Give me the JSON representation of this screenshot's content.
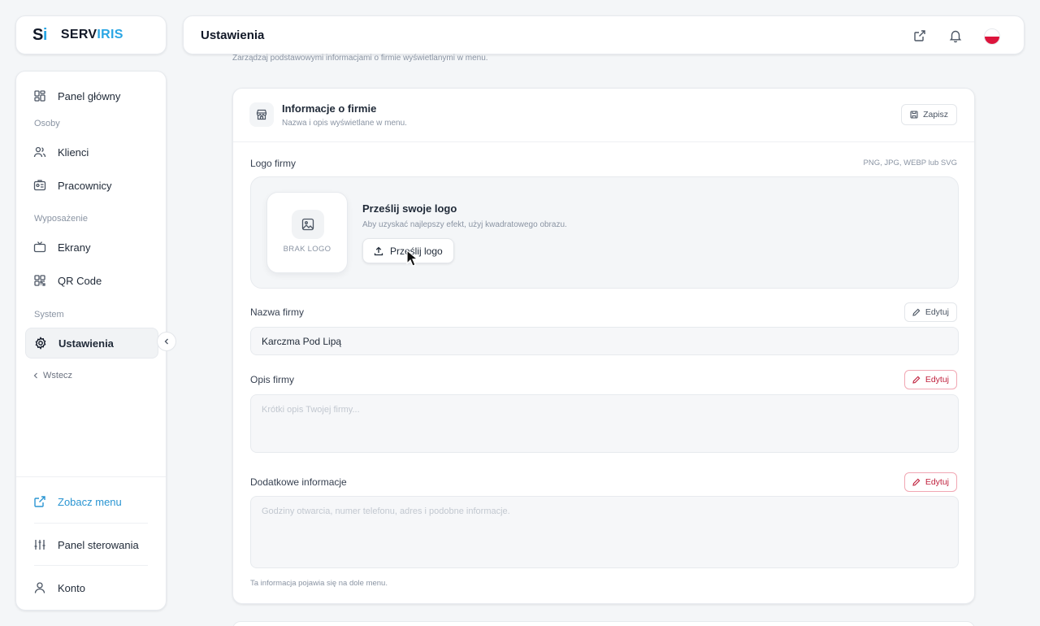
{
  "brand": {
    "mark_s": "S",
    "mark_i": "i",
    "name_main": "SERV",
    "name_accent": "IRIS"
  },
  "sidebar": {
    "items": [
      {
        "label": "Panel główny",
        "icon": "dashboard-icon"
      },
      {
        "label": "Klienci",
        "icon": "users-icon"
      },
      {
        "label": "Pracownicy",
        "icon": "id-card-icon"
      },
      {
        "label": "Ekrany",
        "icon": "tv-icon"
      },
      {
        "label": "QR Code",
        "icon": "qr-code-icon"
      },
      {
        "label": "Ustawienia",
        "icon": "gear-icon",
        "active": true
      }
    ],
    "sections": {
      "people": "Osoby",
      "equipment": "Wyposażenie",
      "system": "System"
    },
    "back_label": "Wstecz",
    "bottom": {
      "view_menu": "Zobacz menu",
      "control_panel": "Panel sterowania",
      "account": "Konto"
    }
  },
  "topbar": {
    "title": "Ustawienia",
    "icons": [
      "external-link-icon",
      "bell-icon",
      "poland-flag-icon"
    ]
  },
  "page": {
    "subtitle": "Zarządzaj podstawowymi informacjami o firmie wyświetlanymi w menu."
  },
  "card": {
    "title": "Informacje o firmie",
    "subtitle": "Nazwa i opis wyświetlane w menu.",
    "save_label": "Zapisz",
    "logo": {
      "label": "Logo firmy",
      "formats": "PNG, JPG, WEBP lub SVG",
      "placeholder": "BRAK LOGO",
      "upload_title": "Prześlij swoje logo",
      "upload_hint": "Aby uzyskać najlepszy efekt, użyj kwadratowego obrazu.",
      "upload_button": "Prześlij logo"
    },
    "name": {
      "label": "Nazwa firmy",
      "edit": "Edytuj",
      "value": "Karczma Pod Lipą"
    },
    "description": {
      "label": "Opis firmy",
      "edit": "Edytuj",
      "placeholder": "Krótki opis Twojej firmy..."
    },
    "extra": {
      "label": "Dodatkowe informacje",
      "edit": "Edytuj",
      "placeholder": "Godziny otwarcia, numer telefonu, adres i podobne informacje.",
      "footnote": "Ta informacja pojawia się na dole menu."
    }
  },
  "colors": {
    "accent": "#2aa6e4",
    "danger": "#c0223e",
    "background": "#f4f6f8"
  }
}
